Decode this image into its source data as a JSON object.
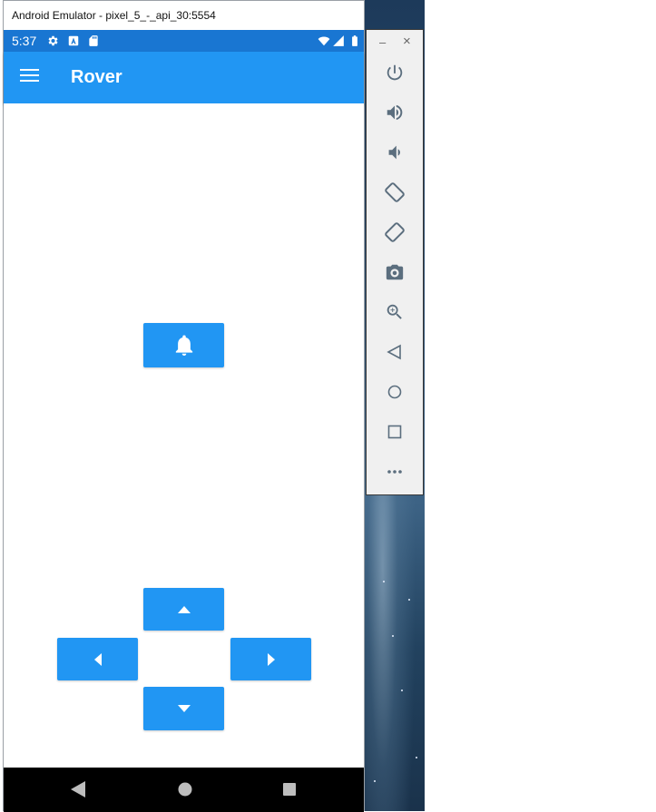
{
  "window": {
    "title": "Android Emulator - pixel_5_-_api_30:5554"
  },
  "status_bar": {
    "time": "5:37",
    "left_icons": [
      "gear-icon",
      "a-badge-icon",
      "sd-card-icon"
    ],
    "right_icons": [
      "wifi-icon",
      "signal-icon",
      "battery-icon"
    ]
  },
  "app_bar": {
    "title": "Rover",
    "menu_icon": "hamburger-menu-icon"
  },
  "controls": {
    "bell": "bell-icon",
    "up": "triangle-up-icon",
    "left": "triangle-left-icon",
    "right": "triangle-right-icon",
    "down": "triangle-down-icon",
    "accent_color": "#2196f3"
  },
  "system_nav": [
    "back-icon",
    "home-icon",
    "recents-icon"
  ],
  "toolbar": {
    "minimize": "–",
    "close": "×",
    "buttons": [
      "power-icon",
      "volume-up-icon",
      "volume-down-icon",
      "rotate-left-icon",
      "rotate-right-icon",
      "camera-icon",
      "zoom-icon",
      "back-icon",
      "home-icon",
      "overview-icon",
      "more-icon"
    ]
  }
}
